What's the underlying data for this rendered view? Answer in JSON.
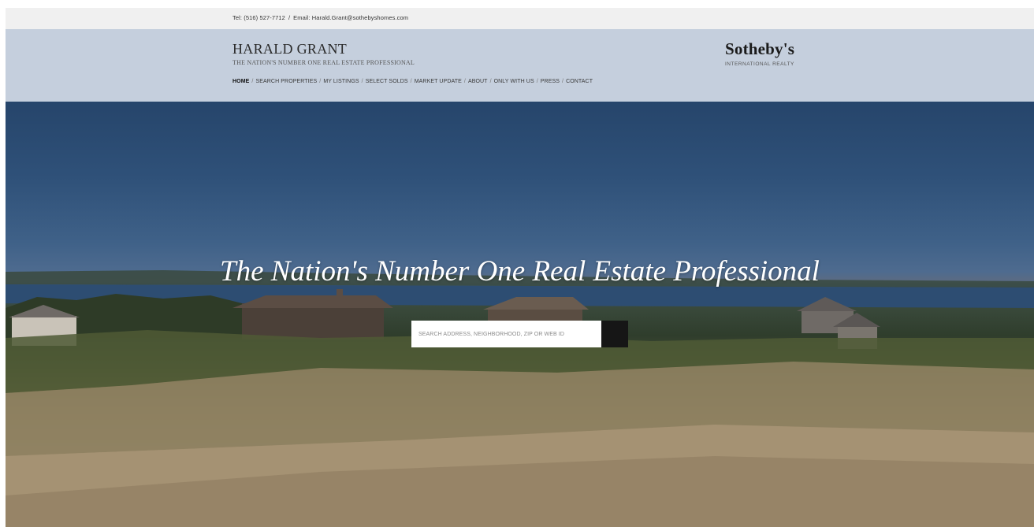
{
  "topbar": {
    "phone": "Tel: (516) 527-7712",
    "separator": "/",
    "email": "Email: Harald.Grant@sothebyshomes.com"
  },
  "header": {
    "name": "HARALD GRANT",
    "tagline": "THE NATION'S NUMBER ONE REAL ESTATE PROFESSIONAL",
    "logo_main": "Sotheby's",
    "logo_sub": "INTERNATIONAL REALTY"
  },
  "nav": {
    "items": [
      "HOME",
      "SEARCH PROPERTIES",
      "MY LISTINGS",
      "SELECT SOLDS",
      "MARKET UPDATE",
      "ABOUT",
      "ONLY WITH US",
      "PRESS",
      "CONTACT"
    ],
    "separator": "/",
    "active_index": 0
  },
  "hero": {
    "title": "The Nation's Number One Real Estate Professional",
    "search_placeholder": "SEARCH ADDRESS, NEIGHBORHOOD, ZIP OR WEB ID",
    "search_icon": "search-icon"
  },
  "colors": {
    "topbar_bg": "#f0f0f0",
    "header_bg": "#c5cfdd",
    "search_button_bg": "#161616"
  }
}
